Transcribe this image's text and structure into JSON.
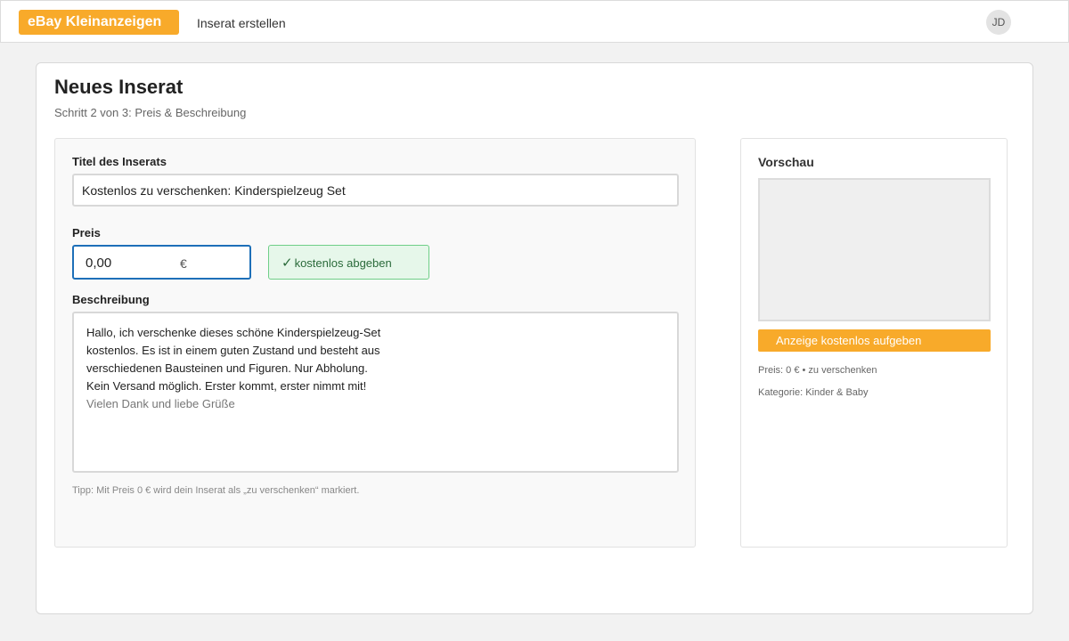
{
  "header": {
    "brand": "eBay Kleinanzeigen",
    "nav_link": "Inserat erstellen",
    "avatar_initials": "JD"
  },
  "page": {
    "title": "Neues Inserat",
    "subtitle": "Schritt 2 von 3: Preis & Beschreibung"
  },
  "form": {
    "title_label": "Titel des Inserats",
    "title_value": "Kostenlos zu verschenken: Kinderspielzeug Set",
    "price_label": "Preis",
    "price_value": "0,00",
    "currency": "€",
    "free_badge": "kostenlos abgeben",
    "description_label": "Beschreibung",
    "description_lines": [
      "Hallo, ich verschenke dieses schöne Kinderspielzeug-Set",
      "kostenlos. Es ist in einem guten Zustand und besteht aus",
      "verschiedenen Bausteinen und Figuren. Nur Abholung.",
      "Kein Versand möglich. Erster kommt, erster nimmt mit!",
      "Vielen Dank und liebe Grüße"
    ],
    "tip": "Tipp: Mit Preis 0 € wird dein Inserat als „zu verschenken“ markiert."
  },
  "preview": {
    "title": "Vorschau",
    "publish_button": "Anzeige kostenlos aufgeben",
    "price_meta": "Preis: 0 € • zu verschenken",
    "category_meta": "Kategorie: Kinder & Baby"
  },
  "colors": {
    "accent": "#f8aa2a",
    "focus_border": "#1d6fb8",
    "success_bg": "#e6f7ea",
    "success_border": "#6fcf88"
  },
  "icons": {
    "free_badge_icon": "check-icon"
  }
}
